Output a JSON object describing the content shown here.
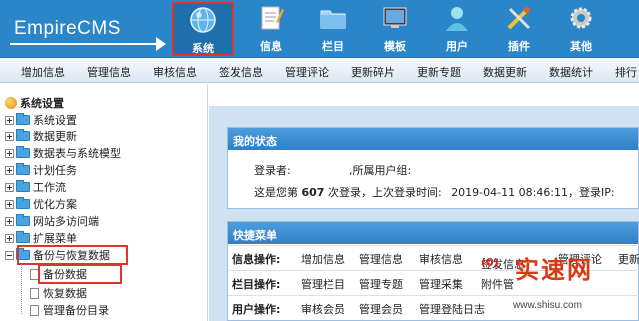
{
  "app": {
    "logo": "EmpireCMS"
  },
  "topnav": [
    {
      "label": "系统",
      "icon": "globe-icon",
      "active": true
    },
    {
      "label": "信息",
      "icon": "notepad-icon"
    },
    {
      "label": "栏目",
      "icon": "folder-icon"
    },
    {
      "label": "模板",
      "icon": "template-icon"
    },
    {
      "label": "用户",
      "icon": "user-icon"
    },
    {
      "label": "插件",
      "icon": "tools-icon"
    },
    {
      "label": "其他",
      "icon": "gear-icon"
    }
  ],
  "subnav": [
    "增加信息",
    "管理信息",
    "审核信息",
    "签发信息",
    "管理评论",
    "更新碎片",
    "更新专题",
    "数据更新",
    "数据统计",
    "排行"
  ],
  "sidebar": {
    "root": "系统设置",
    "items": [
      "系统设置",
      "数据更新",
      "数据表与系统模型",
      "计划任务",
      "工作流",
      "优化方案",
      "网站多访问端",
      "扩展菜单",
      "备份与恢复数据"
    ],
    "children": [
      "备份数据",
      "恢复数据",
      "管理备份目录"
    ]
  },
  "status": {
    "title": "我的状态",
    "login_label": "登录者:",
    "group_label": ",所属用户组:",
    "visit_prefix": "这是您第",
    "visit_count": "607",
    "visit_suffix": "次登录，上次登录时间:",
    "last_time": "2019-04-11 08:46:11",
    "ip_label": "，登录IP:"
  },
  "quick": {
    "title": "快捷菜单",
    "rows": [
      {
        "label": "信息操作:",
        "links": [
          "增加信息",
          "管理信息",
          "审核信息",
          "签发信息",
          "(0)",
          "管理评论",
          "更新"
        ]
      },
      {
        "label": "栏目操作:",
        "links": [
          "管理栏目",
          "管理专题",
          "管理采集",
          "附件管"
        ]
      },
      {
        "label": "用户操作:",
        "links": [
          "审核会员",
          "管理会员",
          "管理登陆日志"
        ]
      }
    ]
  },
  "watermark": {
    "big": "实速网",
    "small": "www.shisu.com"
  }
}
